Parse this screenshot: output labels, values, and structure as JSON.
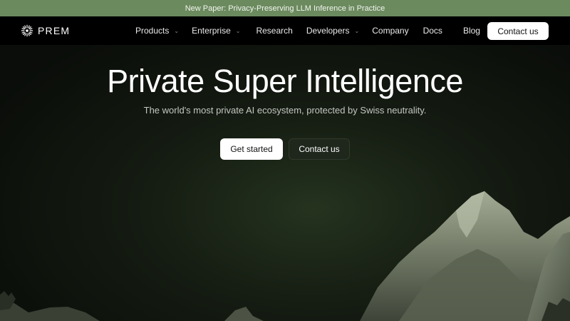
{
  "banner": {
    "text": "New Paper: Privacy-Preserving LLM Inference in Practice"
  },
  "nav": {
    "logo_text": "PREM",
    "logo_icon": "prem-logo-icon",
    "items": [
      {
        "label": "Products",
        "dropdown": true
      },
      {
        "label": "Enterprise",
        "dropdown": true
      },
      {
        "label": "Research",
        "dropdown": false
      },
      {
        "label": "Developers",
        "dropdown": true
      },
      {
        "label": "Company",
        "dropdown": false
      },
      {
        "label": "Docs",
        "dropdown": false
      },
      {
        "label": "Blog",
        "dropdown": false
      }
    ],
    "cta_label": "Contact us"
  },
  "hero": {
    "title": "Private Super Intelligence",
    "subtitle": "The world's most private AI ecosystem, protected by Swiss neutrality.",
    "primary_button": "Get started",
    "secondary_button": "Contact us"
  },
  "colors": {
    "banner": "#6b8a5e",
    "background": "#0a0d09",
    "mountain": "#8f977f"
  }
}
